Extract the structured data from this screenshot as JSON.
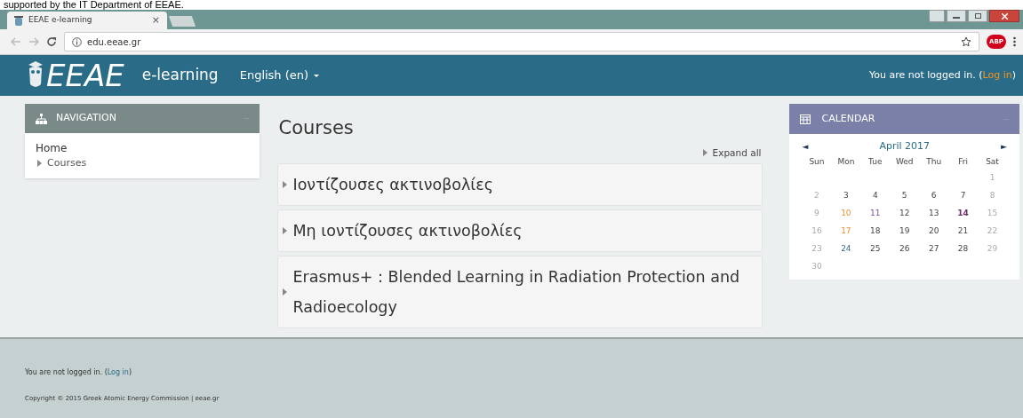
{
  "caption": "supported by the IT Department of EEAE.",
  "browser": {
    "tab_title": "EEAE e-learning",
    "tab_close": "×",
    "url": "edu.eeae.gr",
    "extension_badge": "ABP"
  },
  "header": {
    "logo": "EEAE",
    "site_name": "e-learning",
    "language": "English (en)",
    "login_text": "You are not logged in. (",
    "login_link": "Log in",
    "login_end": ")"
  },
  "navigation": {
    "title": "NAVIGATION",
    "items": [
      {
        "label": "Home",
        "children": [
          {
            "label": "Courses"
          }
        ]
      }
    ]
  },
  "main": {
    "title": "Courses",
    "expand_all": "Expand all",
    "courses": [
      {
        "name": "Ιοντίζουσες ακτινοβολίες"
      },
      {
        "name": "Μη ιοντίζουσες ακτινοβολίες"
      },
      {
        "name": "Erasmus+ : Blended Learning in Radiation Protection and Radioecology"
      }
    ]
  },
  "calendar": {
    "title": "CALENDAR",
    "prev": "◄",
    "month": "April 2017",
    "next": "►",
    "weekdays": [
      "Sun",
      "Mon",
      "Tue",
      "Wed",
      "Thu",
      "Fri",
      "Sat"
    ],
    "weeks": [
      [
        {
          "day": "1",
          "kind": "weekend"
        }
      ],
      [
        {
          "day": "2",
          "kind": "weekend"
        },
        {
          "day": "3",
          "kind": "weekday"
        },
        {
          "day": "4",
          "kind": "weekday"
        },
        {
          "day": "5",
          "kind": "weekday"
        },
        {
          "day": "6",
          "kind": "weekday"
        },
        {
          "day": "7",
          "kind": "weekday"
        },
        {
          "day": "8",
          "kind": "weekend"
        }
      ],
      [
        {
          "day": "9",
          "kind": "weekend"
        },
        {
          "day": "10",
          "kind": "course"
        },
        {
          "day": "11",
          "kind": "group"
        },
        {
          "day": "12",
          "kind": "weekday"
        },
        {
          "day": "13",
          "kind": "weekday"
        },
        {
          "day": "14",
          "kind": "today"
        },
        {
          "day": "15",
          "kind": "weekend"
        }
      ],
      [
        {
          "day": "16",
          "kind": "weekend"
        },
        {
          "day": "17",
          "kind": "course"
        },
        {
          "day": "18",
          "kind": "weekday"
        },
        {
          "day": "19",
          "kind": "weekday"
        },
        {
          "day": "20",
          "kind": "weekday"
        },
        {
          "day": "21",
          "kind": "weekday"
        },
        {
          "day": "22",
          "kind": "weekend"
        }
      ],
      [
        {
          "day": "23",
          "kind": "weekend"
        },
        {
          "day": "24",
          "kind": "user"
        },
        {
          "day": "25",
          "kind": "weekday"
        },
        {
          "day": "26",
          "kind": "weekday"
        },
        {
          "day": "27",
          "kind": "weekday"
        },
        {
          "day": "28",
          "kind": "weekday"
        },
        {
          "day": "29",
          "kind": "weekend"
        }
      ],
      [
        {
          "day": "30",
          "kind": "weekend"
        }
      ]
    ]
  },
  "footer": {
    "login_text": "You are not logged in. (",
    "login_link": "Log in",
    "login_end": ")",
    "copyright": "Copyright © 2015 Greek Atomic Energy Commission | eeae.gr"
  }
}
